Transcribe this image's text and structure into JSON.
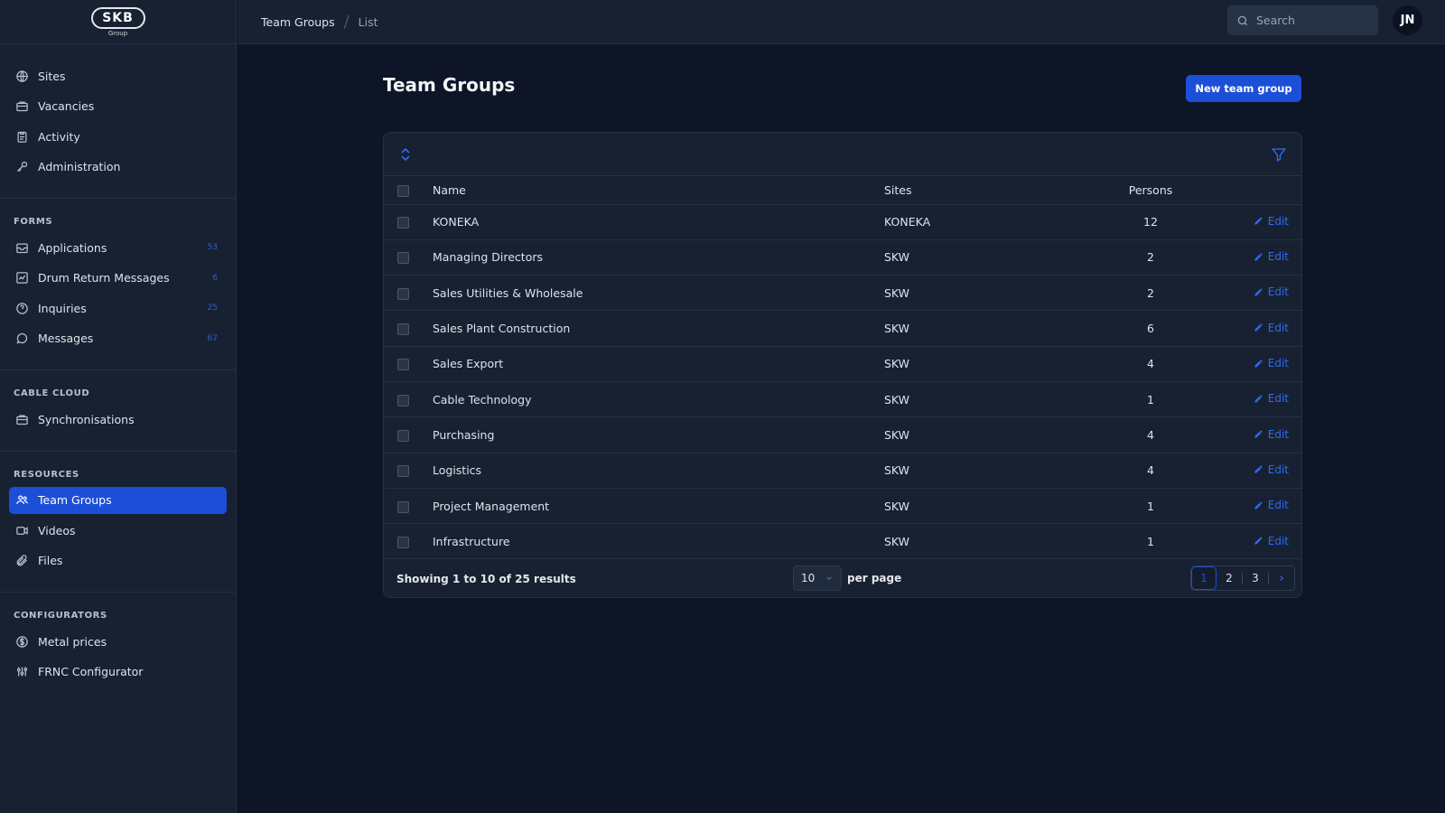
{
  "brand": {
    "mark": "SKB",
    "sub": "Group"
  },
  "sidebar": {
    "main_items": [
      {
        "label": "Sites",
        "icon": "globe-icon"
      },
      {
        "label": "Vacancies",
        "icon": "briefcase-icon"
      },
      {
        "label": "Activity",
        "icon": "clipboard-icon"
      },
      {
        "label": "Administration",
        "icon": "key-icon"
      }
    ],
    "forms": {
      "title": "FORMS",
      "items": [
        {
          "label": "Applications",
          "badge": "53"
        },
        {
          "label": "Drum Return Messages",
          "badge": "6"
        },
        {
          "label": "Inquiries",
          "badge": "25"
        },
        {
          "label": "Messages",
          "badge": "67"
        }
      ]
    },
    "cable_cloud": {
      "title": "CABLE CLOUD",
      "items": [
        {
          "label": "Synchronisations"
        }
      ]
    },
    "resources": {
      "title": "RESOURCES",
      "items": [
        {
          "label": "Team Groups",
          "active": true
        },
        {
          "label": "Videos"
        },
        {
          "label": "Files"
        }
      ]
    },
    "configurators": {
      "title": "CONFIGURATORS",
      "items": [
        {
          "label": "Metal prices"
        },
        {
          "label": "FRNC Configurator"
        }
      ]
    }
  },
  "topbar": {
    "breadcrumb": [
      "Team Groups",
      "List"
    ],
    "search_placeholder": "Search",
    "avatar_initials": "JN"
  },
  "main": {
    "title": "Team Groups",
    "new_button": "New team group",
    "table": {
      "columns": [
        "Name",
        "Sites",
        "Persons"
      ],
      "edit_label": "Edit",
      "rows": [
        {
          "name": "KONEKA",
          "sites": "KONEKA",
          "persons": "12"
        },
        {
          "name": "Managing Directors",
          "sites": "SKW",
          "persons": "2"
        },
        {
          "name": "Sales Utilities & Wholesale",
          "sites": "SKW",
          "persons": "2"
        },
        {
          "name": "Sales Plant Construction",
          "sites": "SKW",
          "persons": "6"
        },
        {
          "name": "Sales Export",
          "sites": "SKW",
          "persons": "4"
        },
        {
          "name": "Cable Technology",
          "sites": "SKW",
          "persons": "1"
        },
        {
          "name": "Purchasing",
          "sites": "SKW",
          "persons": "4"
        },
        {
          "name": "Logistics",
          "sites": "SKW",
          "persons": "4"
        },
        {
          "name": "Project Management",
          "sites": "SKW",
          "persons": "1"
        },
        {
          "name": "Infrastructure",
          "sites": "SKW",
          "persons": "1"
        }
      ]
    },
    "footer": {
      "showing": "Showing 1 to 10 of 25 results",
      "per_page_value": "10",
      "per_page_label": "per page",
      "pages": [
        "1",
        "2",
        "3"
      ],
      "current_page": "1"
    }
  },
  "colors": {
    "accent": "#1d4ed8",
    "background": "#0d1526",
    "sidebar": "#172132"
  }
}
